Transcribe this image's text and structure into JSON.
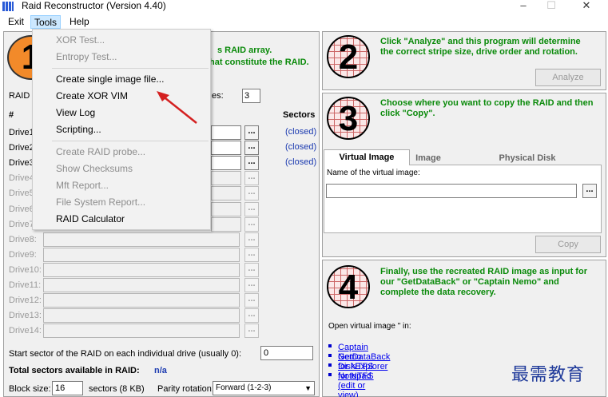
{
  "window": {
    "title": "Raid Reconstructor (Version 4.40)",
    "minimize": "–",
    "maximize": "☐",
    "close": "✕"
  },
  "menubar": {
    "exit": "Exit",
    "tools": "Tools",
    "help": "Help"
  },
  "tools_menu": {
    "xor_test": "XOR Test...",
    "entropy_test": "Entropy Test...",
    "create_single_image": "Create single image file...",
    "create_xor_vim": "Create XOR VIM",
    "view_log": "View Log",
    "scripting": "Scripting...",
    "create_raid_probe": "Create RAID probe...",
    "show_checksums": "Show Checksums",
    "mft_report": "Mft Report...",
    "fs_report": "File System Report...",
    "raid_calculator": "RAID Calculator"
  },
  "step1": {
    "number": "1",
    "text_line1": "s RAID array.",
    "text_line2": "hat constitute the RAID.",
    "raid_label": "RAID",
    "drives_suffix": "es:",
    "drives_count": "3",
    "col_hash": "#",
    "col_sectors": "Sectors",
    "drives": [
      {
        "label": "Drive1",
        "status": "(closed)"
      },
      {
        "label": "Drive2",
        "status": "(closed)"
      },
      {
        "label": "Drive3",
        "status": "(closed)"
      },
      {
        "label": "Drive4",
        "status": ""
      },
      {
        "label": "Drive5",
        "status": ""
      },
      {
        "label": "Drive6",
        "status": ""
      },
      {
        "label": "Drive7",
        "status": ""
      },
      {
        "label": "Drive8:",
        "status": ""
      },
      {
        "label": "Drive9:",
        "status": ""
      },
      {
        "label": "Drive10:",
        "status": ""
      },
      {
        "label": "Drive11:",
        "status": ""
      },
      {
        "label": "Drive12:",
        "status": ""
      },
      {
        "label": "Drive13:",
        "status": ""
      },
      {
        "label": "Drive14:",
        "status": ""
      }
    ],
    "dots": "...",
    "start_sector_label": "Start sector of the RAID on each individual drive (usually 0):",
    "start_sector_value": "0",
    "total_label": "Total sectors available in RAID:",
    "total_value": "n/a",
    "block_size_label": "Block size:",
    "block_size_value": "16",
    "sectors_kb": "sectors (8 KB)",
    "parity_label": "Parity rotation:",
    "parity_value": "Forward (1-2-3)"
  },
  "step2": {
    "number": "2",
    "text": "Click \"Analyze\" and this program will determine the correct stripe size, drive order and rotation.",
    "button": "Analyze"
  },
  "step3": {
    "number": "3",
    "text": "Choose where you want to copy the RAID and then click \"Copy\".",
    "tabs": [
      "Virtual Image",
      "Image",
      "Physical Disk"
    ],
    "name_label": "Name of the virtual image:",
    "name_value": "",
    "dots": "...",
    "button": "Copy"
  },
  "step4": {
    "number": "4",
    "text": "Finally, use the recreated RAID image as input for our \"GetDataBack\" or \"Captain Nemo\" and complete the data recovery.",
    "open_label": "Open virtual image \" in:",
    "links": [
      "Captain Nemo",
      "GetDataBack for NTFS",
      "DiskExplorer for NTFS",
      "Notepad (edit or view)"
    ]
  },
  "watermark": "最需教育",
  "colors": {
    "accent_green": "#0a8a0a",
    "menu_highlight": "#cce8ff",
    "circle_orange": "#f28a2a",
    "arrow_red": "#d42020"
  }
}
